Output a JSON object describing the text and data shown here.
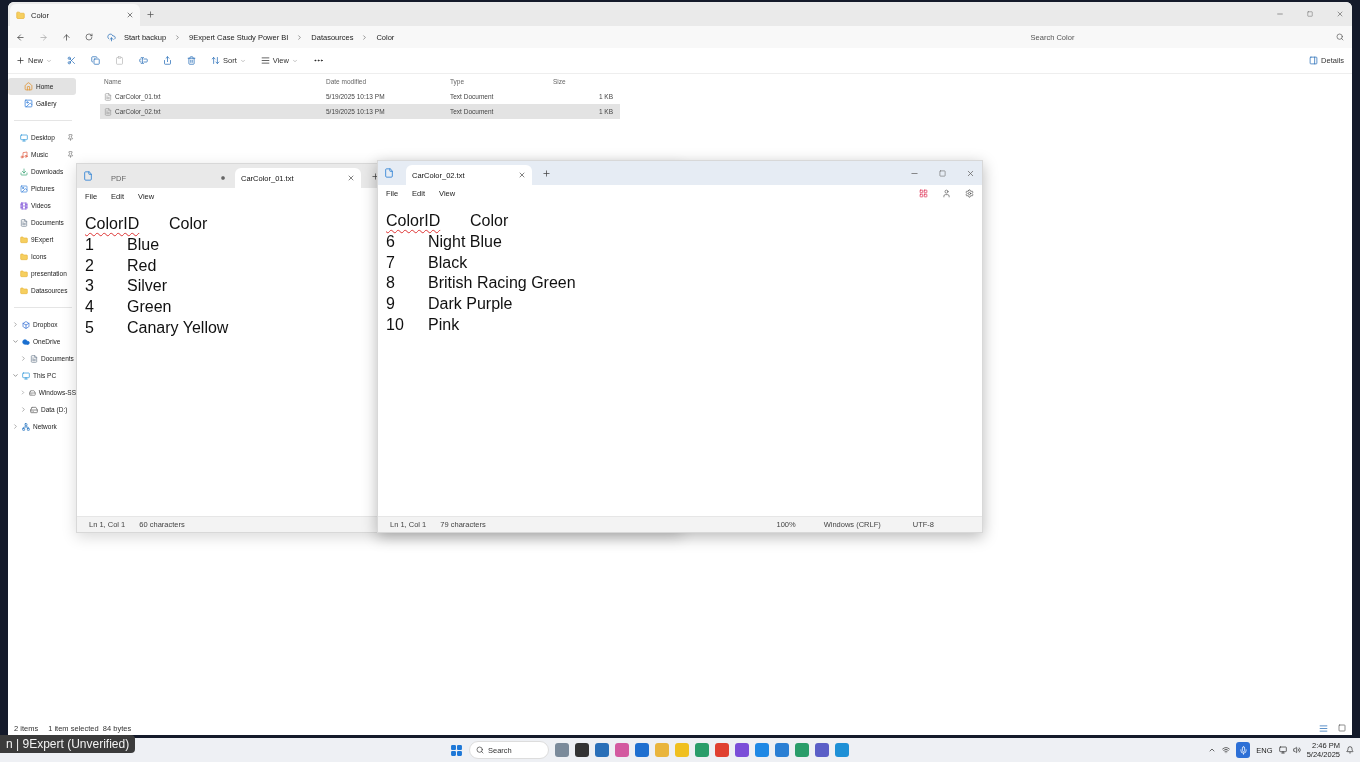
{
  "explorer": {
    "tab": {
      "title": "Color"
    },
    "address": {
      "breadcrumbs": [
        "Start backup",
        "9Expert Case Study Power BI",
        "Datasources",
        "Color"
      ],
      "search_placeholder": "Search Color"
    },
    "commands": [
      {
        "kind": "new",
        "label": "New"
      },
      {
        "kind": "cut"
      },
      {
        "kind": "copy"
      },
      {
        "kind": "paste",
        "disabled": true
      },
      {
        "kind": "rename"
      },
      {
        "kind": "share"
      },
      {
        "kind": "delete"
      },
      {
        "kind": "sort",
        "label": "Sort"
      },
      {
        "kind": "view",
        "label": "View"
      },
      {
        "kind": "more"
      }
    ],
    "details_label": "Details",
    "sidebar": {
      "quick": [
        {
          "kind": "home",
          "label": "Home",
          "selected": true
        },
        {
          "kind": "gallery",
          "label": "Gallery",
          "selected": false
        }
      ],
      "places": [
        {
          "kind": "desktop",
          "label": "Desktop",
          "selected": false,
          "pinned": true
        },
        {
          "kind": "music",
          "label": "Music",
          "selected": false,
          "pinned": true
        },
        {
          "kind": "downloads",
          "label": "Downloads",
          "selected": false,
          "pinned": false
        },
        {
          "kind": "pictures",
          "label": "Pictures",
          "selected": false,
          "pinned": false
        },
        {
          "kind": "videos",
          "label": "Videos",
          "selected": false,
          "pinned": false
        },
        {
          "kind": "documents",
          "label": "Documents",
          "selected": false,
          "pinned": false
        },
        {
          "kind": "folder",
          "label": "9Expert",
          "selected": false,
          "pinned": false
        },
        {
          "kind": "folder",
          "label": "Icons",
          "selected": false,
          "pinned": false
        },
        {
          "kind": "folder",
          "label": "presentation",
          "selected": false,
          "pinned": false
        },
        {
          "kind": "folder",
          "label": "Datasources",
          "selected": false,
          "pinned": false
        }
      ],
      "tree": [
        {
          "kind": "dropbox",
          "label": "Dropbox",
          "expanded": false
        },
        {
          "kind": "cloud",
          "label": "OneDrive",
          "expanded": true,
          "children": [
            {
              "kind": "documents",
              "label": "Documents",
              "expanded": false
            }
          ]
        },
        {
          "kind": "pc",
          "label": "This PC",
          "expanded": true,
          "children": [
            {
              "kind": "drive",
              "label": "Windows-SS",
              "expanded": false
            },
            {
              "kind": "drive",
              "label": "Data (D:)",
              "expanded": false
            }
          ]
        },
        {
          "kind": "network",
          "label": "Network",
          "expanded": false
        }
      ]
    },
    "files": {
      "columns": [
        "Name",
        "Date modified",
        "Type",
        "Size"
      ],
      "rows": [
        {
          "name": "CarColor_01.txt",
          "date": "5/19/2025 10:13 PM",
          "type": "Text Document",
          "size": "1 KB",
          "selected": false
        },
        {
          "name": "CarColor_02.txt",
          "date": "5/19/2025 10:13 PM",
          "type": "Text Document",
          "size": "1 KB",
          "selected": true
        }
      ]
    },
    "status": [
      "2 items",
      "1 item selected  84 bytes"
    ]
  },
  "notepads": [
    {
      "active": false,
      "tabs": [
        {
          "label": "PDF",
          "selected": false,
          "modified": true
        },
        {
          "label": "CarColor_01.txt",
          "selected": true,
          "modified": false
        }
      ],
      "menu": [
        "File",
        "Edit",
        "View"
      ],
      "header": {
        "columns": [
          "ColorID",
          "Color"
        ],
        "misspelled_first": true
      },
      "rows": [
        [
          "1",
          "Blue"
        ],
        [
          "2",
          "Red"
        ],
        [
          "3",
          "Silver"
        ],
        [
          "4",
          "Green"
        ],
        [
          "5",
          "Canary Yellow"
        ]
      ],
      "status": {
        "position": "Ln 1, Col 1",
        "characters": "60 characters"
      }
    },
    {
      "active": true,
      "tabs": [
        {
          "label": "CarColor_02.txt",
          "selected": true,
          "modified": false
        }
      ],
      "menu": [
        "File",
        "Edit",
        "View"
      ],
      "header": {
        "columns": [
          "ColorID",
          "Color"
        ],
        "misspelled_first": true
      },
      "rows": [
        [
          "6",
          "Night Blue"
        ],
        [
          "7",
          "Black"
        ],
        [
          "8",
          "British Racing Green"
        ],
        [
          "9",
          "Dark Purple"
        ],
        [
          "10",
          "Pink"
        ]
      ],
      "status": {
        "position": "Ln 1, Col 1",
        "characters": "79 characters",
        "zoom": "100%",
        "line_ending": "Windows (CRLF)",
        "encoding": "UTF-8"
      }
    }
  ],
  "overlay_label": "n | 9Expert (Unverified)",
  "taskbar": {
    "search": "Search",
    "language": "ENG",
    "time": "2:46 PM",
    "date": "5/24/2025"
  }
}
